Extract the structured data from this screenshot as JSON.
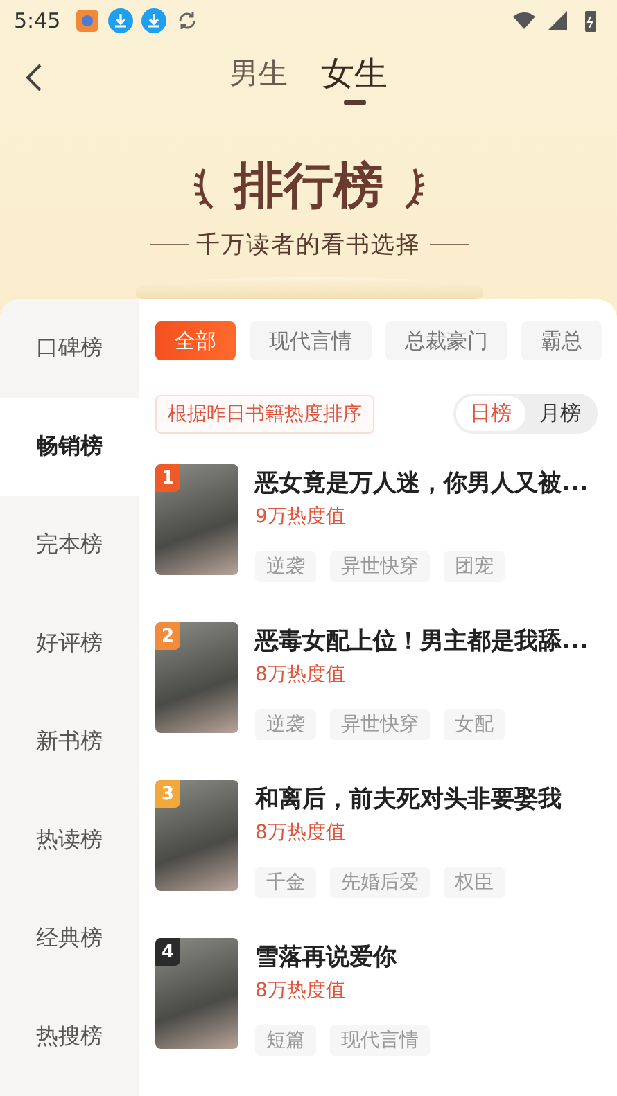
{
  "status_bar": {
    "time": "5:45"
  },
  "header": {
    "tabs": [
      {
        "label": "男生",
        "selected": false
      },
      {
        "label": "女生",
        "selected": true
      }
    ]
  },
  "banner": {
    "title": "排行榜",
    "subtitle": "千万读者的看书选择"
  },
  "sidebar": {
    "items": [
      {
        "label": "口碑榜",
        "selected": false
      },
      {
        "label": "畅销榜",
        "selected": true
      },
      {
        "label": "完本榜",
        "selected": false
      },
      {
        "label": "好评榜",
        "selected": false
      },
      {
        "label": "新书榜",
        "selected": false
      },
      {
        "label": "热读榜",
        "selected": false
      },
      {
        "label": "经典榜",
        "selected": false
      },
      {
        "label": "热搜榜",
        "selected": false
      }
    ]
  },
  "filters": [
    {
      "label": "全部",
      "selected": true
    },
    {
      "label": "现代言情",
      "selected": false
    },
    {
      "label": "总裁豪门",
      "selected": false
    },
    {
      "label": "霸总",
      "selected": false
    }
  ],
  "sort_note": "根据昨日书籍热度排序",
  "period_toggle": [
    {
      "label": "日榜",
      "selected": true
    },
    {
      "label": "月榜",
      "selected": false
    }
  ],
  "books": [
    {
      "rank": "1",
      "color": "#f05a28",
      "title": "恶女竟是万人迷，你男人又被...",
      "heat": "9万热度值",
      "tags": [
        "逆袭",
        "异世快穿",
        "团宠"
      ]
    },
    {
      "rank": "2",
      "color": "#f28c3c",
      "title": "恶毒女配上位！男主都是我舔...",
      "heat": "8万热度值",
      "tags": [
        "逆袭",
        "异世快穿",
        "女配"
      ]
    },
    {
      "rank": "3",
      "color": "#f3a83a",
      "title": "和离后，前夫死对头非要娶我",
      "heat": "8万热度值",
      "tags": [
        "千金",
        "先婚后爱",
        "权臣"
      ]
    },
    {
      "rank": "4",
      "color": "#2b2b2b",
      "title": "雪落再说爱你",
      "heat": "8万热度值",
      "tags": [
        "短篇",
        "现代言情"
      ]
    }
  ]
}
